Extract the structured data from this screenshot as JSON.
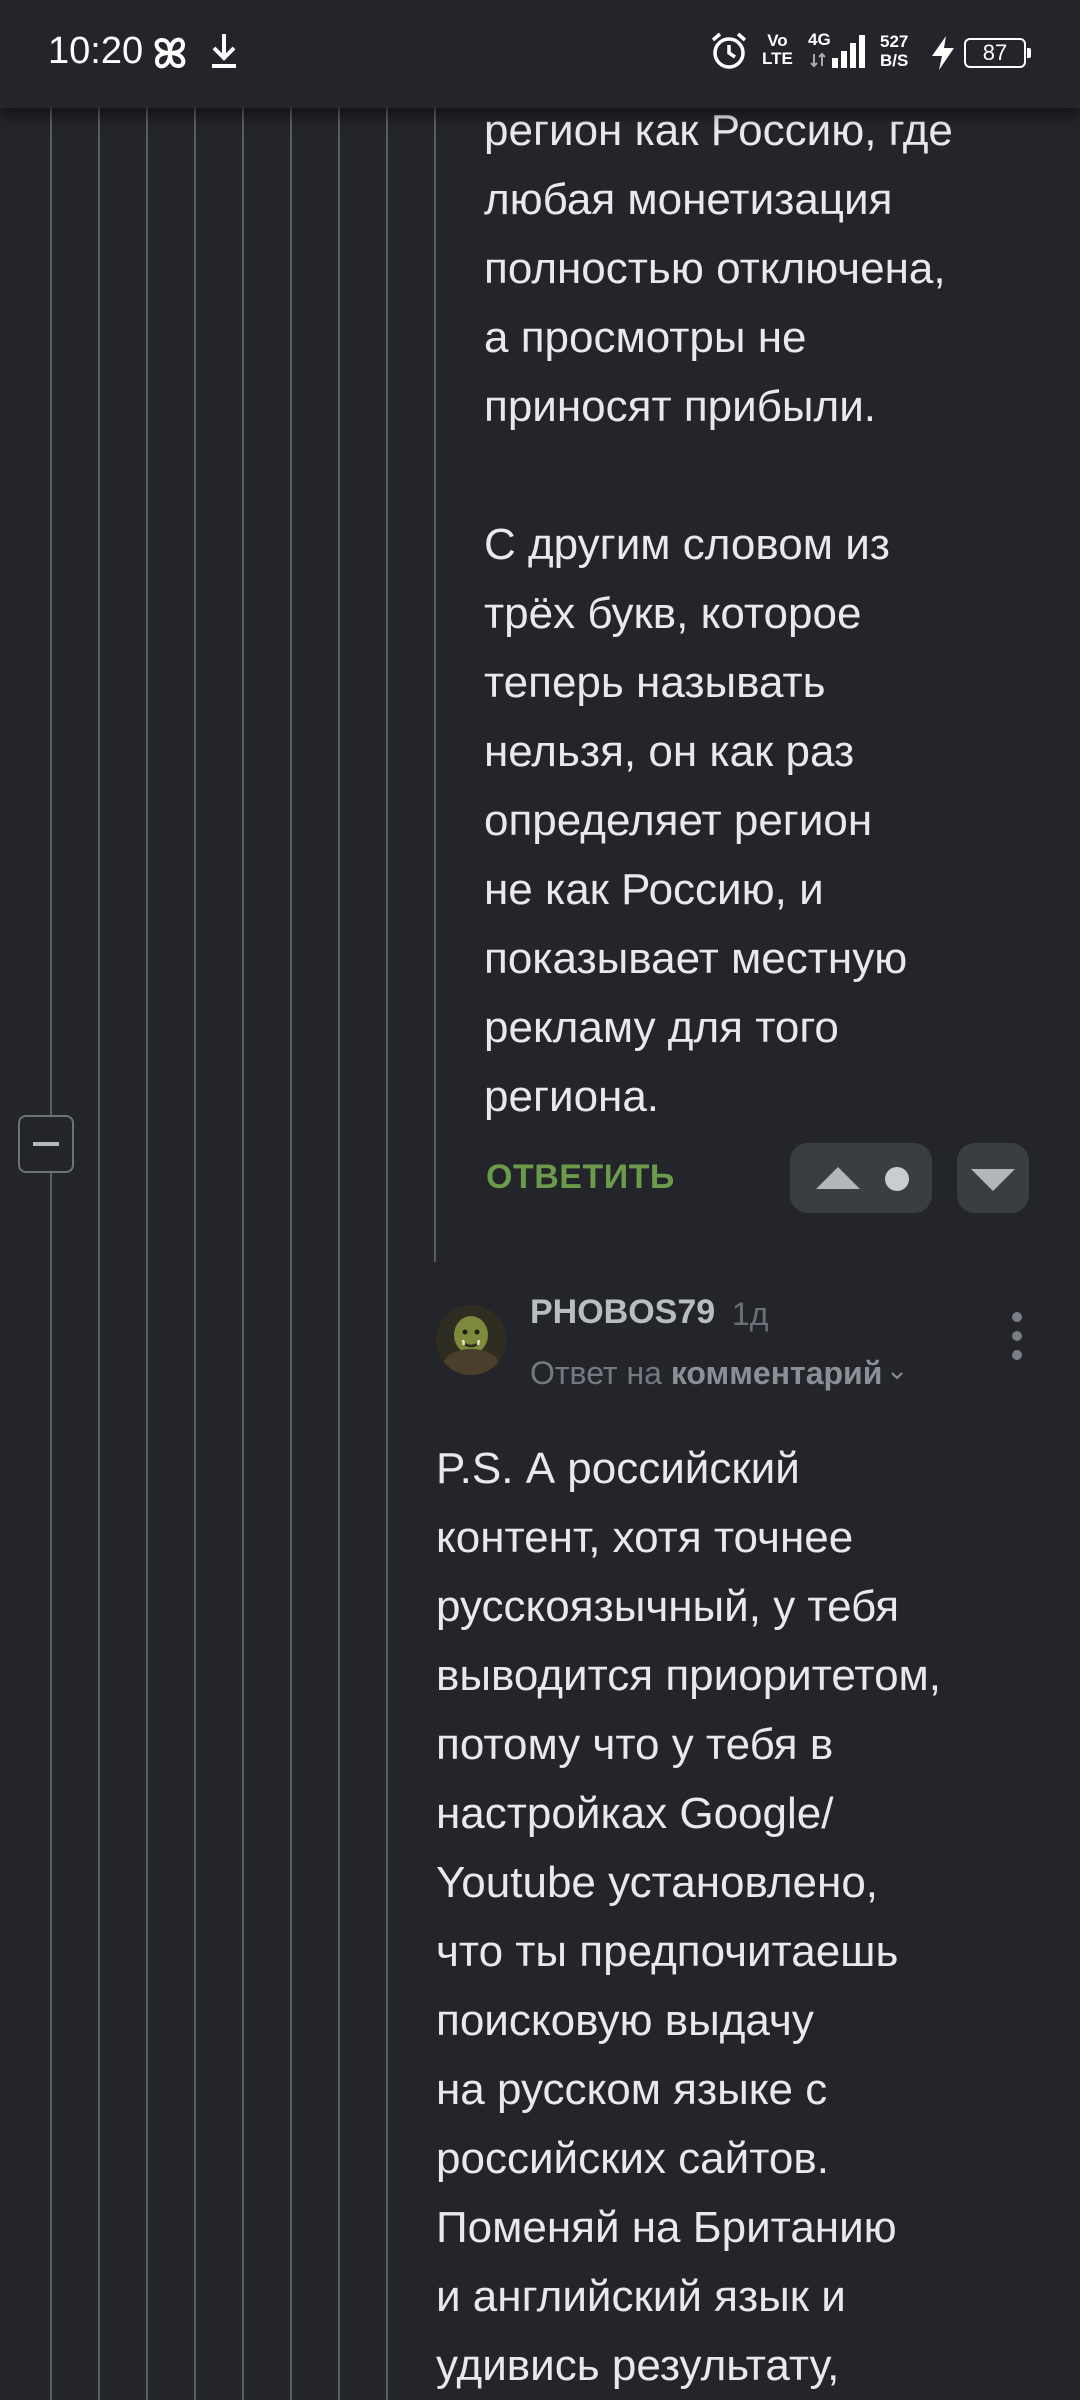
{
  "status_bar": {
    "time": "10:20",
    "volte_top": "Vo",
    "volte_bottom": "LTE",
    "network": "4G",
    "speed_value": "527",
    "speed_unit": "B/S",
    "battery": "87",
    "icons": [
      "pinwheel-icon",
      "download-icon",
      "alarm-icon",
      "signal-icon",
      "charging-bolt-icon",
      "battery-icon"
    ]
  },
  "comments": [
    {
      "text": "регион как Россию, где\nлюбая монетизация\nполностью отключена,\nа просмотры не\nприносят прибыли.\n\nС другим словом из\nтрёх букв, которое\nтеперь называть\nнельзя, он как раз\nопределяет регион\nне как Россию, и\nпоказывает местную\nрекламу для того\nрегиона.",
      "reply_label": "ОТВЕТИТЬ"
    },
    {
      "author": "PHOBOS79",
      "time_ago": "1д",
      "reply_to_prefix": "Ответ на",
      "reply_to_target": "комментарий",
      "text": "P.S. А российский\nконтент, хотя точнее\nрусскоязычный, у тебя\nвыводится приоритетом,\nпотому что у тебя в\nнастройках Google/\nYoutube установлено,\nчто ты предпочитаешь\nпоисковую выдачу\nна русском языке с\nроссийских сайтов.\nПоменяй на Британию\nи английский язык и\nудивись результату,"
    }
  ],
  "colors": {
    "background": "#23252a",
    "text": "#e8e9eb",
    "reply_link": "#6b9a4a",
    "thread_line": "#5a5d63",
    "button_bg": "#3a3d42"
  }
}
